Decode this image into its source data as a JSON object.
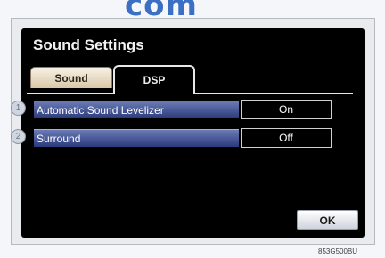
{
  "watermark": "com",
  "window": {
    "title": "Sound Settings"
  },
  "tabs": {
    "sound_label": "Sound",
    "dsp_label": "DSP",
    "active": "DSP"
  },
  "rows": [
    {
      "number": "1",
      "label": "Automatic Sound Levelizer",
      "value": "On"
    },
    {
      "number": "2",
      "label": "Surround",
      "value": "Off"
    }
  ],
  "ok_label": "OK",
  "image_code": "853G500BU"
}
